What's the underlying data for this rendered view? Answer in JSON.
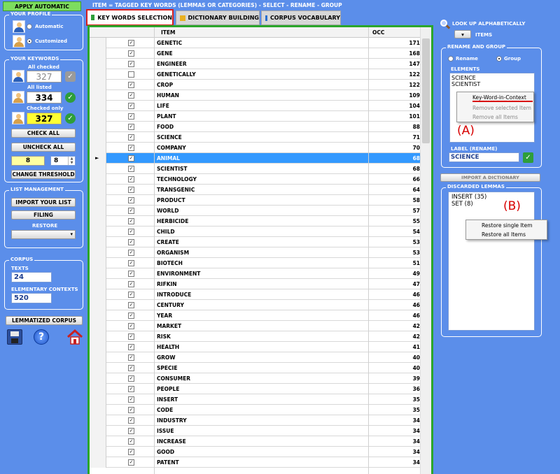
{
  "header_title": "ITEM = TAGGED KEY WORDS (LEMMAS OR CATEGORIES) - SELECT - RENAME - GROUP",
  "left": {
    "apply_button": "APPLY AUTOMATIC",
    "profile": {
      "title": "YOUR PROFILE",
      "automatic": "Automatic",
      "customized": "Customized",
      "selected": "customized"
    },
    "keywords": {
      "title": "YOUR KEYWORDS",
      "all_checked_label": "All checked",
      "all_checked_value": "327",
      "all_listed_label": "All listed",
      "all_listed_value": "334",
      "checked_only_label": "Checked only",
      "checked_only_value": "327",
      "check_all": "CHECK ALL",
      "uncheck_all": "UNCHECK ALL",
      "threshold_value": "8",
      "threshold_spin": "8",
      "change_threshold": "CHANGE THRESHOLD"
    },
    "list_management": {
      "title": "LIST MANAGEMENT",
      "import": "IMPORT YOUR LIST",
      "filing": "FILING",
      "restore": "RESTORE"
    },
    "corpus": {
      "title": "CORPUS",
      "texts_label": "TEXTS",
      "texts_value": "24",
      "contexts_label": "ELEMENTARY CONTEXTS",
      "contexts_value": "520"
    },
    "lemmatized": "LEMMATIZED CORPUS",
    "icons": [
      "save-icon",
      "help-icon",
      "home-icon"
    ]
  },
  "tabs": [
    {
      "label": "KEY WORDS SELECTION",
      "color": "#2e9e3a",
      "active": true
    },
    {
      "label": "DICTIONARY BUILDING",
      "color": "#e8b020",
      "active": false
    },
    {
      "label": "CORPUS VOCABULARY",
      "color": "#2a6fd0",
      "active": false
    }
  ],
  "table": {
    "col_item": "ITEM",
    "col_occ": "OCC",
    "selected_index": 11,
    "rows": [
      {
        "item": "GENETIC",
        "occ": "171",
        "checked": true
      },
      {
        "item": "GENE",
        "occ": "168",
        "checked": true
      },
      {
        "item": "ENGINEER",
        "occ": "147",
        "checked": true
      },
      {
        "item": "GENETICALLY",
        "occ": "122",
        "checked": false
      },
      {
        "item": "CROP",
        "occ": "122",
        "checked": true
      },
      {
        "item": "HUMAN",
        "occ": "109",
        "checked": true
      },
      {
        "item": "LIFE",
        "occ": "104",
        "checked": true
      },
      {
        "item": "PLANT",
        "occ": "101",
        "checked": true
      },
      {
        "item": "FOOD",
        "occ": "88",
        "checked": true
      },
      {
        "item": "SCIENCE",
        "occ": "71",
        "checked": true
      },
      {
        "item": "COMPANY",
        "occ": "70",
        "checked": true
      },
      {
        "item": "ANIMAL",
        "occ": "68",
        "checked": true
      },
      {
        "item": "SCIENTIST",
        "occ": "68",
        "checked": true
      },
      {
        "item": "TECHNOLOGY",
        "occ": "66",
        "checked": true
      },
      {
        "item": "TRANSGENIC",
        "occ": "64",
        "checked": true
      },
      {
        "item": "PRODUCT",
        "occ": "58",
        "checked": true
      },
      {
        "item": "WORLD",
        "occ": "57",
        "checked": true
      },
      {
        "item": "HERBICIDE",
        "occ": "55",
        "checked": true
      },
      {
        "item": "CHILD",
        "occ": "54",
        "checked": true
      },
      {
        "item": "CREATE",
        "occ": "53",
        "checked": true
      },
      {
        "item": "ORGANISM",
        "occ": "53",
        "checked": true
      },
      {
        "item": "BIOTECH",
        "occ": "51",
        "checked": true
      },
      {
        "item": "ENVIRONMENT",
        "occ": "49",
        "checked": true
      },
      {
        "item": "RIFKIN",
        "occ": "47",
        "checked": true
      },
      {
        "item": "INTRODUCE",
        "occ": "46",
        "checked": true
      },
      {
        "item": "CENTURY",
        "occ": "46",
        "checked": true
      },
      {
        "item": "YEAR",
        "occ": "46",
        "checked": true
      },
      {
        "item": "MARKET",
        "occ": "42",
        "checked": true
      },
      {
        "item": "RISK",
        "occ": "42",
        "checked": true
      },
      {
        "item": "HEALTH",
        "occ": "41",
        "checked": true
      },
      {
        "item": "GROW",
        "occ": "40",
        "checked": true
      },
      {
        "item": "SPECIE",
        "occ": "40",
        "checked": true
      },
      {
        "item": "CONSUMER",
        "occ": "39",
        "checked": true
      },
      {
        "item": "PEOPLE",
        "occ": "36",
        "checked": true
      },
      {
        "item": "INSERT",
        "occ": "35",
        "checked": true
      },
      {
        "item": "CODE",
        "occ": "35",
        "checked": true
      },
      {
        "item": "INDUSTRY",
        "occ": "34",
        "checked": true
      },
      {
        "item": "ISSUE",
        "occ": "34",
        "checked": true
      },
      {
        "item": "INCREASE",
        "occ": "34",
        "checked": true
      },
      {
        "item": "GOOD",
        "occ": "34",
        "checked": true
      },
      {
        "item": "PATENT",
        "occ": "34",
        "checked": true
      }
    ]
  },
  "right": {
    "lookup": "LOOK UP ALPHABETICALLY",
    "items": "ITEMS",
    "rename_group": {
      "title": "RENAME AND GROUP",
      "rename": "Rename",
      "group": "Group",
      "selected": "group"
    },
    "elements_label": "ELEMENTS",
    "elements": [
      "SCIENCE",
      "SCIENTIST"
    ],
    "context_menu_a": {
      "items": [
        "Key-Word-in-Context",
        "Remove selected Item",
        "Remove all Items"
      ]
    },
    "annotation_a": "(A)",
    "label_rename_title": "LABEL (RENAME)",
    "label_rename_value": "SCIENCE",
    "import_dictionary": "IMPORT A DICTIONARY",
    "discarded_title": "DISCARDED LEMMAS",
    "discarded": [
      "INSERT (35)",
      "SET (8)"
    ],
    "context_menu_b": {
      "items": [
        "Restore single Item",
        "Restore all Items"
      ]
    },
    "annotation_b": "(B)"
  },
  "colors": {
    "background": "#5b8eea",
    "grid_border": "#2ba62b",
    "selection": "#3399ff",
    "annotation": "#d80000",
    "tick": "#2e9e3a",
    "checked_only_bg": "#ffff33"
  }
}
